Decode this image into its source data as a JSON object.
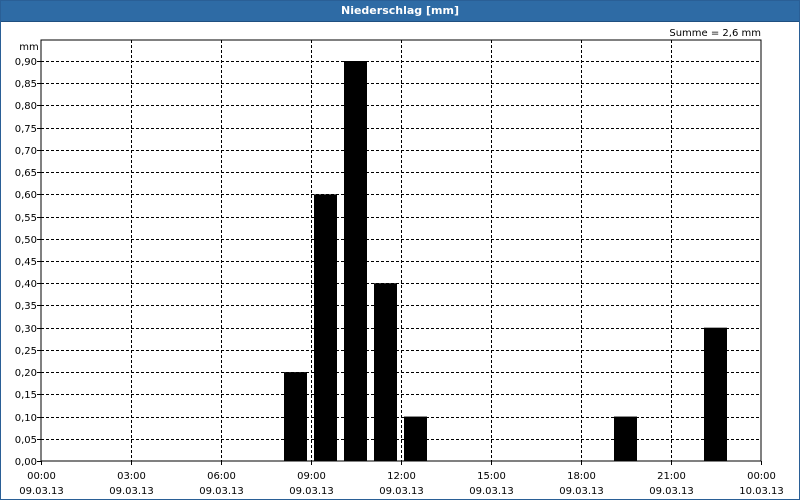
{
  "window": {
    "title": "Niederschlag [mm]"
  },
  "chart_data": {
    "type": "bar",
    "title": "Niederschlag [mm]",
    "ylabel": "mm",
    "xlabel": "",
    "ylim": [
      0,
      0.9
    ],
    "y_ticks": [
      "0,00",
      "0,05",
      "0,10",
      "0,15",
      "0,20",
      "0,25",
      "0,30",
      "0,35",
      "0,40",
      "0,45",
      "0,50",
      "0,55",
      "0,60",
      "0,65",
      "0,70",
      "0,75",
      "0,80",
      "0,85",
      "0,90"
    ],
    "x_ticks": [
      {
        "time": "00:00",
        "date": "09.03.13"
      },
      {
        "time": "03:00",
        "date": "09.03.13"
      },
      {
        "time": "06:00",
        "date": "09.03.13"
      },
      {
        "time": "09:00",
        "date": "09.03.13"
      },
      {
        "time": "12:00",
        "date": "09.03.13"
      },
      {
        "time": "15:00",
        "date": "09.03.13"
      },
      {
        "time": "18:00",
        "date": "09.03.13"
      },
      {
        "time": "21:00",
        "date": "09.03.13"
      },
      {
        "time": "00:00",
        "date": "10.03.13"
      }
    ],
    "x_range_hours": [
      0,
      24
    ],
    "bars": [
      {
        "hour": 8,
        "value": 0.2
      },
      {
        "hour": 9,
        "value": 0.6
      },
      {
        "hour": 10,
        "value": 0.9
      },
      {
        "hour": 11,
        "value": 0.4
      },
      {
        "hour": 12,
        "value": 0.1
      },
      {
        "hour": 19,
        "value": 0.1
      },
      {
        "hour": 22,
        "value": 0.3
      }
    ],
    "annotation": "Summe = 2,6 mm",
    "grid": true,
    "bar_color": "#000000"
  }
}
